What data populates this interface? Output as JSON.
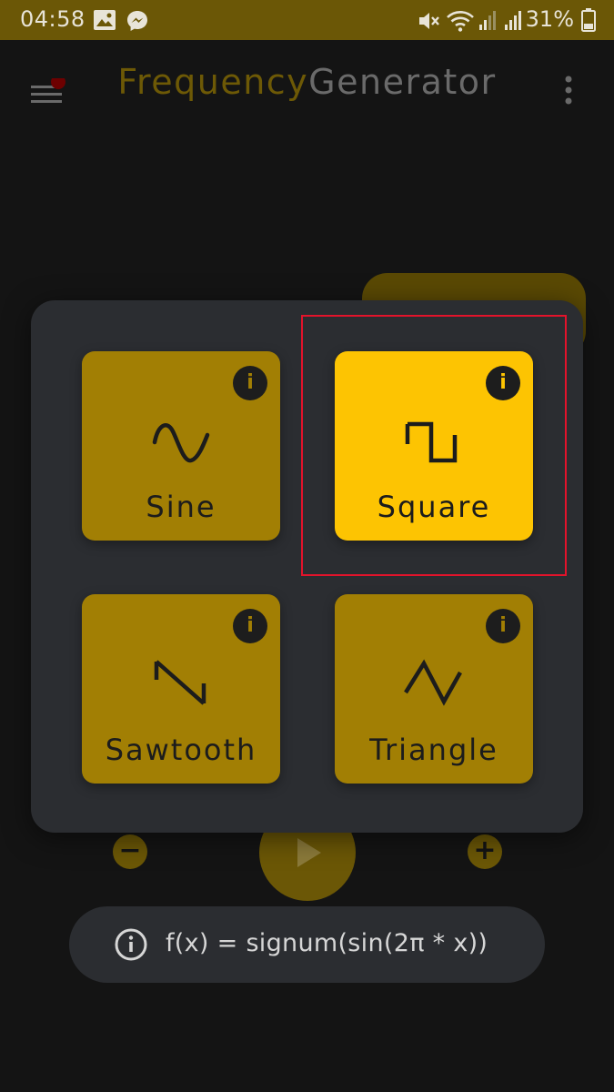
{
  "status_bar": {
    "time": "04:58",
    "battery": "31%"
  },
  "app_bar": {
    "title_part1": "Frequency",
    "title_part2": "Generator"
  },
  "dialog": {
    "tiles": [
      {
        "label": "Sine",
        "icon": "sine-wave-icon",
        "selected": false
      },
      {
        "label": "Square",
        "icon": "square-wave-icon",
        "selected": true
      },
      {
        "label": "Sawtooth",
        "icon": "sawtooth-wave-icon",
        "selected": false
      },
      {
        "label": "Triangle",
        "icon": "triangle-wave-icon",
        "selected": false
      }
    ],
    "info_glyph": "i"
  },
  "controls": {
    "minus": "−",
    "plus": "+"
  },
  "formula": {
    "text": "f(x) = signum(sin(2π * x))"
  },
  "colors": {
    "accent": "#fdc402",
    "accent_dim": "#a27f04",
    "dialog_bg": "#2b2d31",
    "background": "#141414",
    "selection_frame": "#e3132b"
  }
}
